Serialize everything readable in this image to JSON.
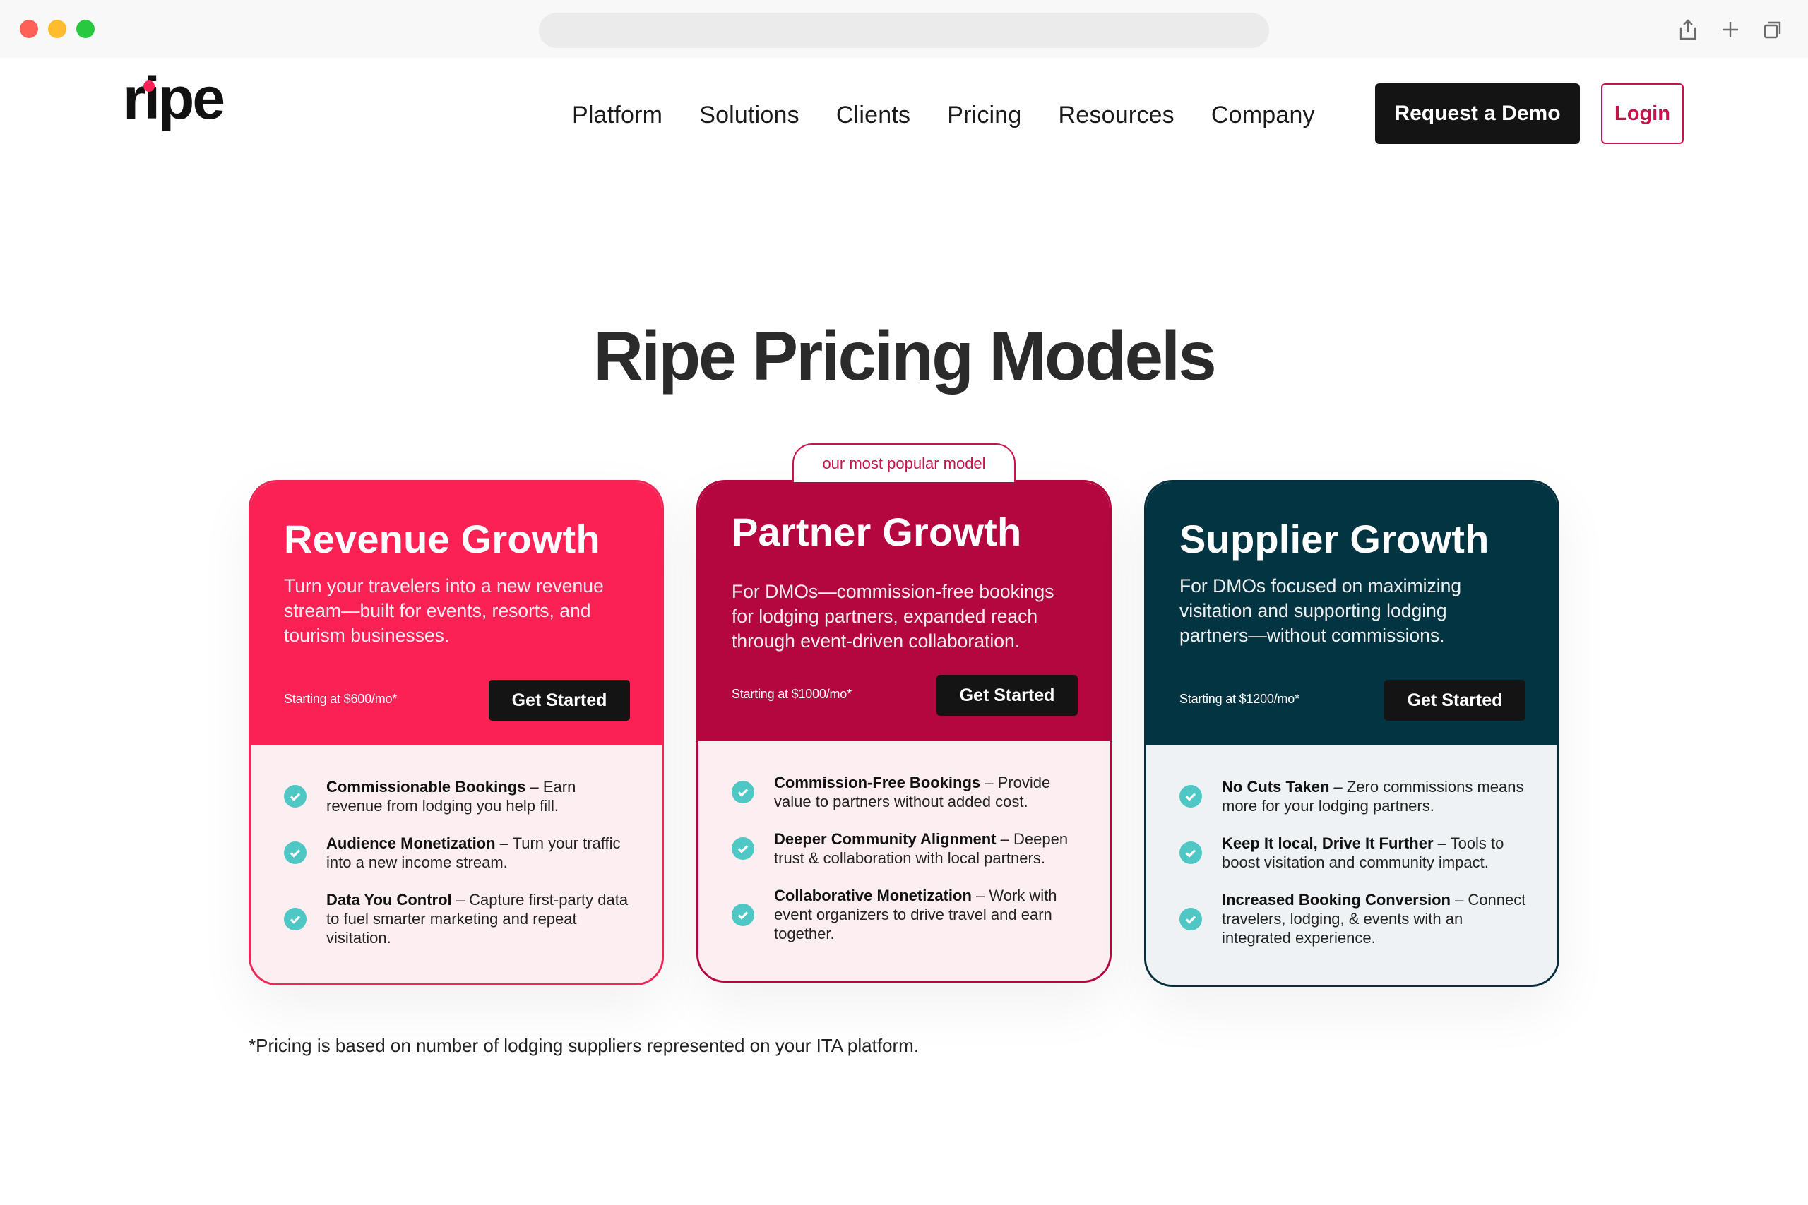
{
  "browser": {
    "icons": [
      "share-icon",
      "new-tab-icon",
      "tabs-overview-icon"
    ]
  },
  "header": {
    "logo_text": "ripe",
    "nav": [
      "Platform",
      "Solutions",
      "Clients",
      "Pricing",
      "Resources",
      "Company"
    ],
    "demo_button": "Request a Demo",
    "login_button": "Login"
  },
  "main": {
    "title": "Ripe Pricing Models",
    "popular_tag": "our most popular model",
    "plans": [
      {
        "name": "Revenue Growth",
        "description": "Turn your travelers into a new revenue stream—built for events, resorts, and tourism businesses.",
        "price": "Starting at $600/mo*",
        "cta": "Get Started",
        "features": [
          {
            "title": "Commissionable Bookings",
            "text": " – Earn revenue from lodging you help fill."
          },
          {
            "title": "Audience Monetization",
            "text": " – Turn your traffic into a new income stream."
          },
          {
            "title": "Data You Control",
            "text": " – Capture first-party data to fuel smarter marketing and repeat visitation."
          }
        ]
      },
      {
        "name": "Partner Growth",
        "description": "For DMOs—commission-free bookings for lodging partners, expanded reach through event-driven collaboration.",
        "price": "Starting at $1000/mo*",
        "cta": "Get Started",
        "features": [
          {
            "title": "Commission-Free Bookings",
            "text": " – Provide value to partners without added cost."
          },
          {
            "title": "Deeper Community Alignment",
            "text": " – Deepen trust & collaboration with local partners."
          },
          {
            "title": "Collaborative Monetization",
            "text": " – Work with event organizers to drive travel and earn together."
          }
        ]
      },
      {
        "name": "Supplier Growth",
        "description": "For DMOs focused on maximizing visitation and supporting lodging partners—without commissions.",
        "price": "Starting at $1200/mo*",
        "cta": "Get Started",
        "features": [
          {
            "title": "No Cuts Taken",
            "text": " – Zero commissions means more for your lodging partners."
          },
          {
            "title": "Keep It local, Drive It Further",
            "text": " – Tools to boost visitation and community impact."
          },
          {
            "title": "Increased Booking Conversion",
            "text": " – Connect travelers, lodging, & events with an integrated experience."
          }
        ]
      }
    ],
    "footnote": "*Pricing is based on number of lodging suppliers represented on your ITA platform."
  },
  "colors": {
    "revenue": "#fc2154",
    "partner": "#b4073f",
    "supplier": "#033442",
    "check": "#4fc7c4",
    "brand_red": "#c8124a"
  }
}
